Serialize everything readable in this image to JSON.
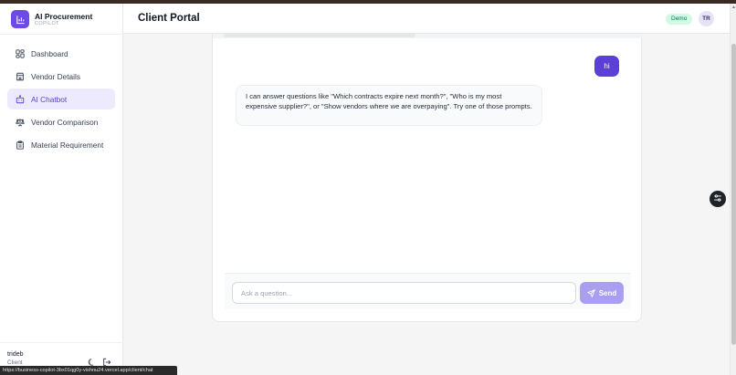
{
  "brand": {
    "title": "AI Procurement",
    "subtitle": "COPILOT"
  },
  "sidebar": {
    "items": [
      {
        "label": "Dashboard",
        "icon": "grid-icon",
        "active": false
      },
      {
        "label": "Vendor Details",
        "icon": "store-icon",
        "active": false
      },
      {
        "label": "AI Chatbot",
        "icon": "bot-icon",
        "active": true
      },
      {
        "label": "Vendor Comparison",
        "icon": "scale-icon",
        "active": false
      },
      {
        "label": "Material Requirement",
        "icon": "clipboard-icon",
        "active": false
      }
    ]
  },
  "user": {
    "name": "trideb",
    "role": "Client"
  },
  "header": {
    "title": "Client Portal",
    "badge": "Demo",
    "avatar_initials": "TR"
  },
  "chat": {
    "messages": [
      {
        "role": "user",
        "text": "hi"
      },
      {
        "role": "assistant",
        "text": "I can answer questions like \"Which contracts expire next month?\", \"Who is my most expensive supplier?\", or \"Show vendors where we are overpaying\". Try one of those prompts."
      }
    ],
    "input": {
      "placeholder": "Ask a question...",
      "value": ""
    },
    "send_label": "Send"
  },
  "status_bar": {
    "url": "https://business-copilot-3bx01qg0y-vishnu24.vercel.app/client/chat"
  },
  "colors": {
    "accent": "#5b3fd6",
    "send_disabled": "#a99ef0",
    "badge_bg": "#d1fae5",
    "badge_text": "#047857"
  }
}
